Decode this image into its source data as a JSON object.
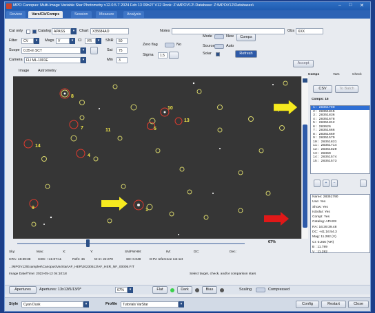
{
  "window": {
    "title": "MPO Canopus: Multi-Image Variable Star Photometry   v12.0.5.7  2024 Feb 13 09h27    V12 Rook: Z:\\MPOV12\\   Database: Z:\\MPOV12\\Databases\\"
  },
  "tabs": [
    "Review",
    "Vars/Ck/Comps",
    "Session",
    "Measure",
    "Analysis"
  ],
  "controls": {
    "cat_only": "Cat only",
    "catalog_label": "Catalog",
    "catalog_value": "APASS",
    "chart_label": "Chart",
    "chart_value": "X35684AO",
    "notes_label": "Notes",
    "obs_label": "Obs",
    "obs_value": "XXX",
    "filter_label": "Filter",
    "filter_value": "CV",
    "mags_label": "Mags",
    "mags_value": "V",
    "ci_label": "CI",
    "ci_value": "VR",
    "snr_label": "SNR",
    "snr_value": "50",
    "zero_flag_label": "Zero flag",
    "zero_flag_state": "No",
    "mode_label": "Mode",
    "mode_state": "New",
    "comps_button": "Comps",
    "scope_label": "Scope",
    "scope_value": "0.35-m SCT",
    "sat_label": "Sat",
    "sat_value": "75",
    "sigma_label": "Sigma",
    "sigma_value": "1.5",
    "source_label": "Source",
    "source_state": "Auto",
    "solar_label": "Solar",
    "refresh_button": "Refresh",
    "accept_button": "Accept",
    "camera_label": "Camera",
    "camera_value": "FLI ML-1001E",
    "min_label": "Min",
    "min_value": "3"
  },
  "image_tabs": [
    "Image",
    "Astrometry"
  ],
  "star_labels": [
    {
      "n": "8"
    },
    {
      "n": "10"
    },
    {
      "n": "13"
    },
    {
      "n": "7"
    },
    {
      "n": "11"
    },
    {
      "n": "5"
    },
    {
      "n": "14"
    },
    {
      "n": "4"
    },
    {
      "n": "9"
    },
    {
      "n": "1"
    }
  ],
  "zoom": "67%",
  "status": {
    "row1": [
      "Sky:",
      "Max:",
      "X:",
      "Y:",
      "SN/FWHM:",
      "IM:",
      "DC:",
      "Dec:"
    ],
    "cra": "CRA: 16:39:38",
    "cdc": "CDC: +41:07:11",
    "refs": "Refs: 46",
    "mm": "M-m: 22.070",
    "sd": "SD: 0.049",
    "dpa": "D-PA reference not set",
    "path": "...\\MPOV12\\Examples\\Canopus\\VarStar\\AF_HER\\20230512\\AF_HER_NF_00005.FIT",
    "datetime": "Image Date/Time: 2023-05-12  04:10:18",
    "hint": "Select target, check, and/or comparison stars"
  },
  "right_panel": {
    "tabs": [
      "Comps",
      "Vars",
      "Check"
    ],
    "csv_button": "CSV",
    "to_batch_button": "To Batch",
    "comps_count": "Comps: 15",
    "comps": [
      "1: 28351790",
      "2: 28351815",
      "3: 28351836",
      "4: 28351678",
      "5: 28351812",
      "6: 283626",
      "7: 28351666",
      "8: 28351669",
      "9: 28351579",
      "10: 28351831",
      "11: 28351714",
      "12: 28351820",
      "13: 28369",
      "14: 28351574",
      "15: 28351573"
    ],
    "info": [
      "Name: 28351790",
      "Use: Yes",
      "Show: Yes",
      "IsSolar: Yes",
      "CompI: Yes",
      "Catalog: APASS",
      "RA: 16:39:39.48",
      "DC: +41:16:54.3",
      "Mag: 11.282 (V)",
      "CI: 0.266 (VR)",
      "B : 11.789",
      "V : 11.282",
      "R : 11.026"
    ]
  },
  "footer": {
    "apertures_button": "Apertures",
    "apertures_text": "Apertures: 13x13/5/13/0*",
    "zoom_select": "67%",
    "flat": "Flat",
    "dark": "Dark",
    "bias": "Bias",
    "scaling": "Scaling",
    "compressed": "Compressed"
  },
  "bottom": {
    "style_label": "Style",
    "style_value": "Cyan Dusk",
    "profile_label": "Profile",
    "profile_value": "Tutorials VarStar",
    "config": "Config",
    "restart": "Restart",
    "close": "Close"
  },
  "colors": {
    "selection": "#2f6fd4",
    "star_marker": "#d4d26a",
    "comp_marker": "#e33b2e",
    "arrow_yellow": "#f6ea1f",
    "arrow_red": "#e01818"
  }
}
